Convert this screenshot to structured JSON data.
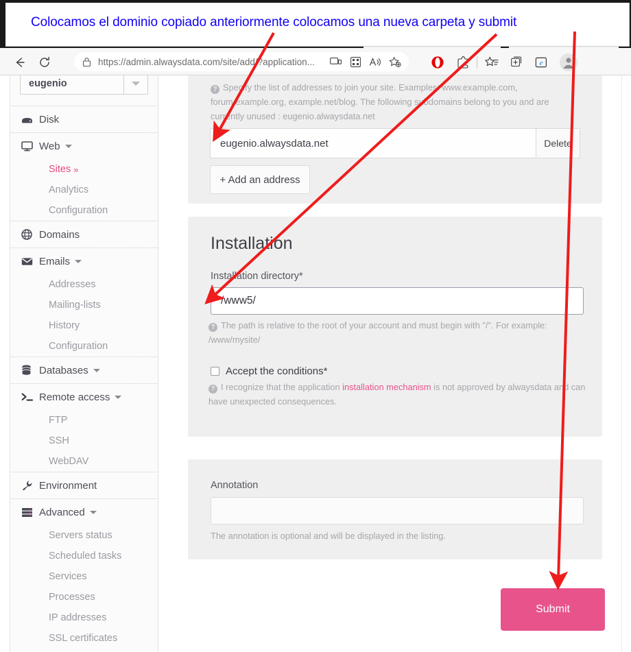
{
  "annotation_overlay": {
    "text": "Colocamos el dominio copiado anteriormente colocamos una nueva carpeta y submit",
    "text_color": "#1200f2",
    "arrow_color": "#ee1c1c"
  },
  "browser": {
    "back_icon": "back-arrow-icon",
    "reload_icon": "reload-icon",
    "lock_icon": "lock-icon",
    "url_prefix": "https://",
    "url_host": "admin.alwaysdata.com",
    "url_path": "/site/add/?application...",
    "url_full": "https://admin.alwaysdata.com/site/add/?application...",
    "url_icons": [
      "split-screen-icon",
      "qr-code-icon",
      "read-aloud-icon",
      "add-favorite-icon"
    ],
    "toolbar_icons": [
      "opera-icon",
      "extensions-icon",
      "collections-icon",
      "add-tab-group-icon",
      "ie-mode-icon"
    ],
    "profile_icon": "profile-avatar-icon"
  },
  "sidebar": {
    "account": {
      "name": "eugenio",
      "caret_icon": "chevron-down-icon"
    },
    "groups": [
      {
        "top": {
          "label": "Disk",
          "icon": "disk-icon",
          "has_dropdown": false
        },
        "items": []
      },
      {
        "top": {
          "label": "Web",
          "icon": "monitor-icon",
          "has_dropdown": true
        },
        "items": [
          {
            "label": "Sites",
            "chevron": "»",
            "active": true
          },
          {
            "label": "Analytics",
            "active": false
          },
          {
            "label": "Configuration",
            "active": false
          }
        ]
      },
      {
        "top": {
          "label": "Domains",
          "icon": "globe-icon",
          "has_dropdown": false
        },
        "items": []
      },
      {
        "top": {
          "label": "Emails",
          "icon": "envelope-icon",
          "has_dropdown": true
        },
        "items": [
          {
            "label": "Addresses",
            "active": false
          },
          {
            "label": "Mailing-lists",
            "active": false
          },
          {
            "label": "History",
            "active": false
          },
          {
            "label": "Configuration",
            "active": false
          }
        ]
      },
      {
        "top": {
          "label": "Databases",
          "icon": "database-icon",
          "has_dropdown": true
        },
        "items": []
      },
      {
        "top": {
          "label": "Remote access",
          "icon": "terminal-icon",
          "has_dropdown": true
        },
        "items": [
          {
            "label": "FTP",
            "active": false
          },
          {
            "label": "SSH",
            "active": false
          },
          {
            "label": "WebDAV",
            "active": false
          }
        ]
      },
      {
        "top": {
          "label": "Environment",
          "icon": "wrench-icon",
          "has_dropdown": false
        },
        "items": []
      },
      {
        "top": {
          "label": "Advanced",
          "icon": "server-icon",
          "has_dropdown": true
        },
        "items": [
          {
            "label": "Servers status",
            "active": false
          },
          {
            "label": "Scheduled tasks",
            "active": false
          },
          {
            "label": "Services",
            "active": false
          },
          {
            "label": "Processes",
            "active": false
          },
          {
            "label": "IP addresses",
            "active": false
          },
          {
            "label": "SSL certificates",
            "active": false
          }
        ]
      }
    ]
  },
  "main": {
    "addresses": {
      "hint": "Specify the list of addresses to join your site. Examples: www.example.com, forum.example.org, example.net/blog. The following subdomains belong to you and are currently unused : eugenio.alwaysdata.net",
      "hint_icon": "help-icon",
      "address_value": "eugenio.alwaysdata.net",
      "delete_label": "Delete",
      "add_label": "+ Add an address"
    },
    "installation": {
      "title": "Installation",
      "directory_label": "Installation directory*",
      "directory_value": "/www5/",
      "directory_hint": "The path is relative to the root of your account and must begin with \"/\". For example: /www/mysite/",
      "directory_hint_icon": "help-icon",
      "accept_label": "Accept the conditions*",
      "accept_checked": false,
      "accept_hint_icon": "help-icon",
      "accept_hint_pre": "I recognize that the application ",
      "accept_hint_link": "installation mechanism",
      "accept_hint_post": " is not approved by alwaysdata and can have unexpected consequences."
    },
    "annotation": {
      "label": "Annotation",
      "value": "",
      "hint": "The annotation is optional and will be displayed in the listing."
    },
    "submit_label": "Submit"
  },
  "colors": {
    "accent_pink": "#e8538c",
    "annotation_blue": "#1200f2",
    "arrow_red": "#ee1c1c",
    "card_gray": "#efefef"
  }
}
